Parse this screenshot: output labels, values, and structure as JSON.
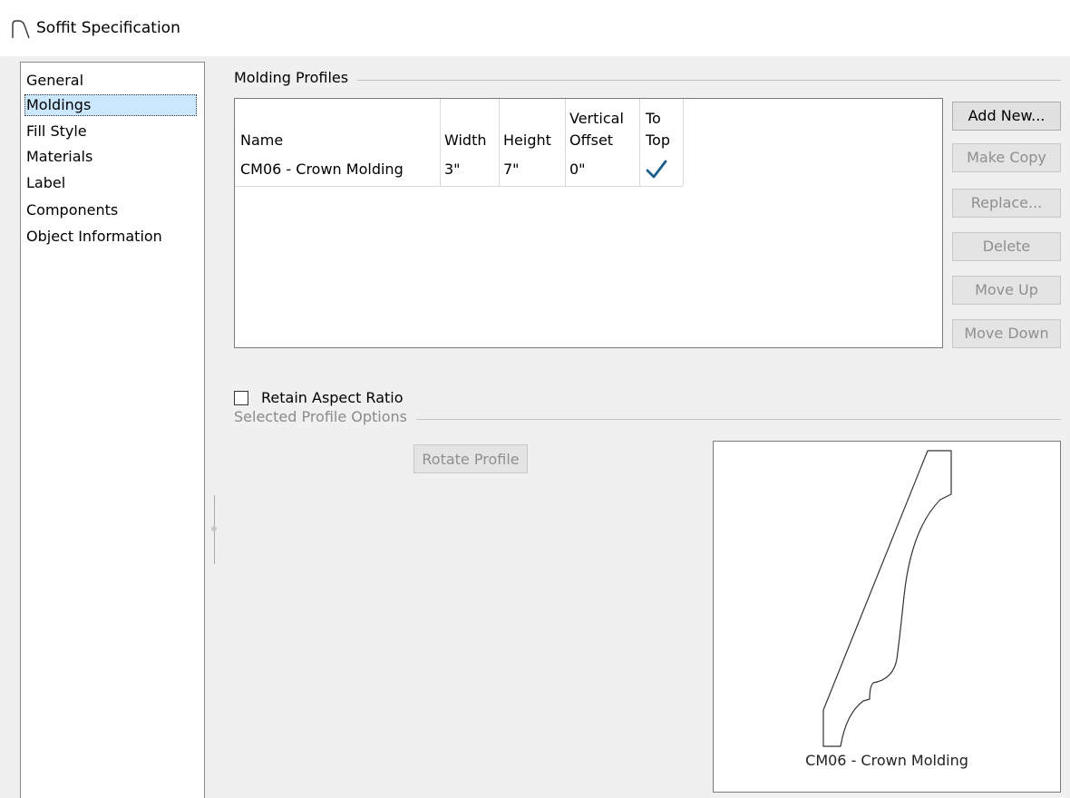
{
  "window": {
    "title": "Soffit Specification",
    "icon": "soffit-arc-icon"
  },
  "nav": {
    "items": [
      "General",
      "Moldings",
      "Fill Style",
      "Materials",
      "Label",
      "Components",
      "Object Information"
    ],
    "selected": "Moldings"
  },
  "molding_profiles": {
    "group_label": "Molding Profiles",
    "columns": {
      "name": "Name",
      "width": "Width",
      "height": "Height",
      "vertical_offset_1": "Vertical",
      "vertical_offset_2": "Offset",
      "to_top_1": "To",
      "to_top_2": "Top"
    },
    "rows": [
      {
        "name": "CM06 - Crown Molding",
        "width": "3\"",
        "height": "7\"",
        "offset": "0\"",
        "to_top": true
      }
    ],
    "check_icon": "checkmark-icon"
  },
  "buttons": {
    "add_new": "Add New...",
    "make_copy": "Make Copy",
    "replace": "Replace...",
    "delete": "Delete",
    "move_up": "Move Up",
    "move_down": "Move Down"
  },
  "retain_aspect_ratio": {
    "label": "Retain Aspect Ratio",
    "checked": false
  },
  "selected_profile_options": {
    "group_label": "Selected Profile Options",
    "rotate_button": "Rotate Profile",
    "preview_label": "CM06 - Crown Molding"
  },
  "colors": {
    "check": "#1b5e8c",
    "selection": "#cce8ff"
  }
}
